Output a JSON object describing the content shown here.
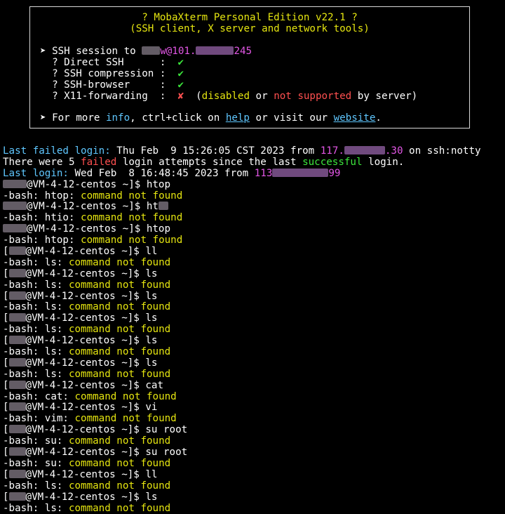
{
  "banner": {
    "title": "? MobaXterm Personal Edition v22.1 ?",
    "subtitle": "(SSH client, X server and network tools)",
    "ssh_session_prefix": "➤ SSH session to ",
    "ssh_user_host": "w@101.",
    "ssh_host_tail": "245",
    "checks": [
      {
        "label": "? Direct SSH      :",
        "status": "✔"
      },
      {
        "label": "? SSH compression :",
        "status": "✔"
      },
      {
        "label": "? SSH-browser     :",
        "status": "✔"
      }
    ],
    "x11_label": "? X11-forwarding  :",
    "x11_status": "✘",
    "x11_open": "(",
    "x11_disabled": "disabled",
    "x11_or": " or ",
    "x11_not_supported": "not supported",
    "x11_by_server": " by server)",
    "more_prefix": "➤ For more ",
    "more_info": "info",
    "more_mid": ", ctrl+click on ",
    "more_help": "help",
    "more_or": " or visit our ",
    "more_website": "website",
    "more_end": "."
  },
  "login": {
    "last_failed_label": "Last failed login:",
    "last_failed_text": " Thu Feb  9 15:26:05 CST 2023 from ",
    "last_failed_ip_head": "117.",
    "last_failed_ip_tail": ".30",
    "last_failed_via": " on ssh:notty",
    "attempts_pre": "There were 5 ",
    "attempts_failed": "failed",
    "attempts_mid": " login attempts since the last ",
    "attempts_success": "successful",
    "attempts_end": " login.",
    "last_label": "Last login:",
    "last_text": " Wed Feb  8 16:48:45 2023 from ",
    "last_ip_head": "113",
    "last_ip_tail": "99"
  },
  "prompt_host": "@VM-4-12-centos ~]$ ",
  "error_prefix": "-bash: ",
  "not_found": "command not found",
  "session": [
    {
      "cmd": "htop",
      "err": "htop: "
    },
    {
      "cmd": "ht",
      "err": "htio: "
    },
    {
      "cmd": "htop",
      "err": "htop: "
    },
    {
      "cmd": "ll",
      "err": "ls: "
    },
    {
      "cmd": "ls",
      "err": "ls: "
    },
    {
      "cmd": "ls",
      "err": "ls: "
    },
    {
      "cmd": "ls",
      "err": "ls: "
    },
    {
      "cmd": "ls",
      "err": "ls: "
    },
    {
      "cmd": "ls",
      "err": "ls: "
    },
    {
      "cmd": "cat",
      "err": "cat: "
    },
    {
      "cmd": "vi",
      "err": "vim: "
    },
    {
      "cmd": "su root",
      "err": "su: "
    },
    {
      "cmd": "su root",
      "err": "su: "
    },
    {
      "cmd": "ll",
      "err": "ls: "
    },
    {
      "cmd": "ls",
      "err": "ls: "
    }
  ],
  "colors": {
    "background": "#000000",
    "cyan": "#5fc7ff",
    "magenta": "#e357e6",
    "green": "#3ce63c",
    "yellow": "#e5e510",
    "red": "#ff5050"
  }
}
